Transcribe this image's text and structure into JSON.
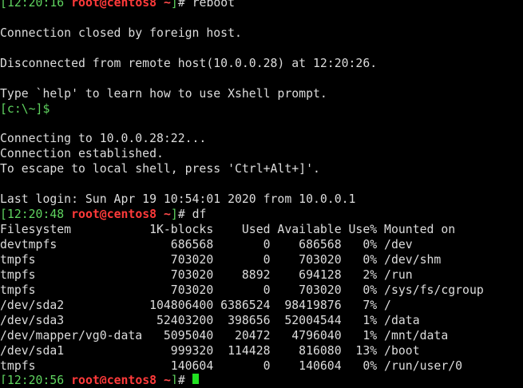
{
  "terminal": {
    "lines": [
      {
        "kind": "prompt",
        "time": "12:20:16",
        "user": "root",
        "at": "@",
        "host": "centos8",
        "path": "~",
        "command": "reboot"
      },
      {
        "kind": "text",
        "text": ""
      },
      {
        "kind": "text",
        "text": "Connection closed by foreign host."
      },
      {
        "kind": "text",
        "text": ""
      },
      {
        "kind": "text",
        "text": "Disconnected from remote host(10.0.0.28) at 12:20:26."
      },
      {
        "kind": "text",
        "text": ""
      },
      {
        "kind": "text",
        "text": "Type `help' to learn how to use Xshell prompt."
      },
      {
        "kind": "local",
        "prompt": "[c:\\~]$"
      },
      {
        "kind": "text",
        "text": ""
      },
      {
        "kind": "text",
        "text": "Connecting to 10.0.0.28:22..."
      },
      {
        "kind": "text",
        "text": "Connection established."
      },
      {
        "kind": "text",
        "text": "To escape to local shell, press 'Ctrl+Alt+]'."
      },
      {
        "kind": "text",
        "text": ""
      },
      {
        "kind": "text",
        "text": "Last login: Sun Apr 19 10:54:01 2020 from 10.0.0.1"
      },
      {
        "kind": "prompt",
        "time": "12:20:48",
        "user": "root",
        "at": "@",
        "host": "centos8",
        "path": "~",
        "command": "df"
      },
      {
        "kind": "text",
        "text": "Filesystem           1K-blocks    Used Available Use% Mounted on"
      },
      {
        "kind": "text",
        "text": "devtmpfs                686568       0    686568   0% /dev"
      },
      {
        "kind": "text",
        "text": "tmpfs                   703020       0    703020   0% /dev/shm"
      },
      {
        "kind": "text",
        "text": "tmpfs                   703020    8892    694128   2% /run"
      },
      {
        "kind": "text",
        "text": "tmpfs                   703020       0    703020   0% /sys/fs/cgroup"
      },
      {
        "kind": "text",
        "text": "/dev/sda2            104806400 6386524  98419876   7% /"
      },
      {
        "kind": "text",
        "text": "/dev/sda3             52403200  398656  52004544   1% /data"
      },
      {
        "kind": "text",
        "text": "/dev/mapper/vg0-data   5095040   20472   4796040   1% /mnt/data"
      },
      {
        "kind": "text",
        "text": "/dev/sda1               999320  114428    816080  13% /boot"
      },
      {
        "kind": "text",
        "text": "tmpfs                   140604       0    140604   0% /run/user/0"
      },
      {
        "kind": "prompt",
        "time": "12:20:56",
        "user": "root",
        "at": "@",
        "host": "centos8",
        "path": "~",
        "command": "",
        "cursor": true
      }
    ]
  },
  "colors": {
    "background": "#000000",
    "text": "#d8d8d8",
    "prompt_user_host": "#ff3a3a",
    "prompt_brackets": "#5fd35f",
    "cursor": "#21e021"
  }
}
